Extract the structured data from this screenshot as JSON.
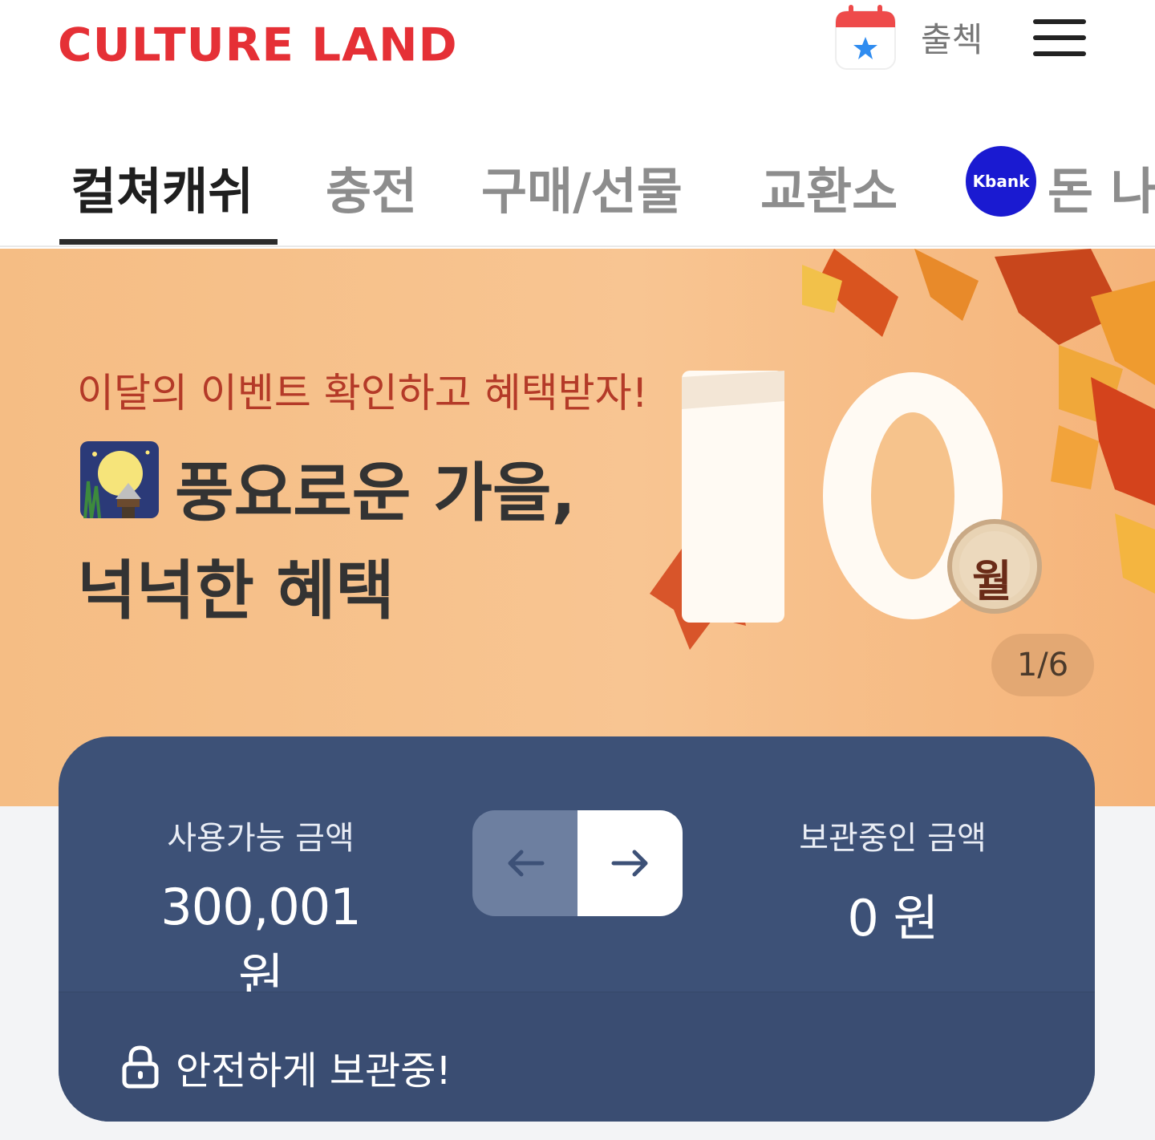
{
  "header": {
    "logo_text": "CULTURE LAND",
    "attendance_label": "출첵"
  },
  "tabs": [
    {
      "label": "컬쳐캐쉬",
      "active": true
    },
    {
      "label": "충전",
      "active": false
    },
    {
      "label": "구매/선물",
      "active": false
    },
    {
      "label": "교환소",
      "active": false
    },
    {
      "label": "돈 나",
      "active": false
    }
  ],
  "kbank_badge": "Kbank",
  "banner": {
    "subtitle": "이달의 이벤트 확인하고 혜택받자!",
    "title_line1": "풍요로운 가을,",
    "title_line2": "넉넉한 혜택",
    "month_number": "10",
    "month_unit": "월",
    "pager": "1/6"
  },
  "wallet": {
    "available_label": "사용가능 금액",
    "available_value": "300,001 원",
    "stored_label": "보관중인 금액",
    "stored_value": "0 원",
    "safe_label": "안전하게 보관중!"
  },
  "colors": {
    "brand_red": "#e53036",
    "wallet_navy": "#3d5177",
    "banner_orange": "#f7c18d",
    "kbank_blue": "#1a1ad1"
  }
}
